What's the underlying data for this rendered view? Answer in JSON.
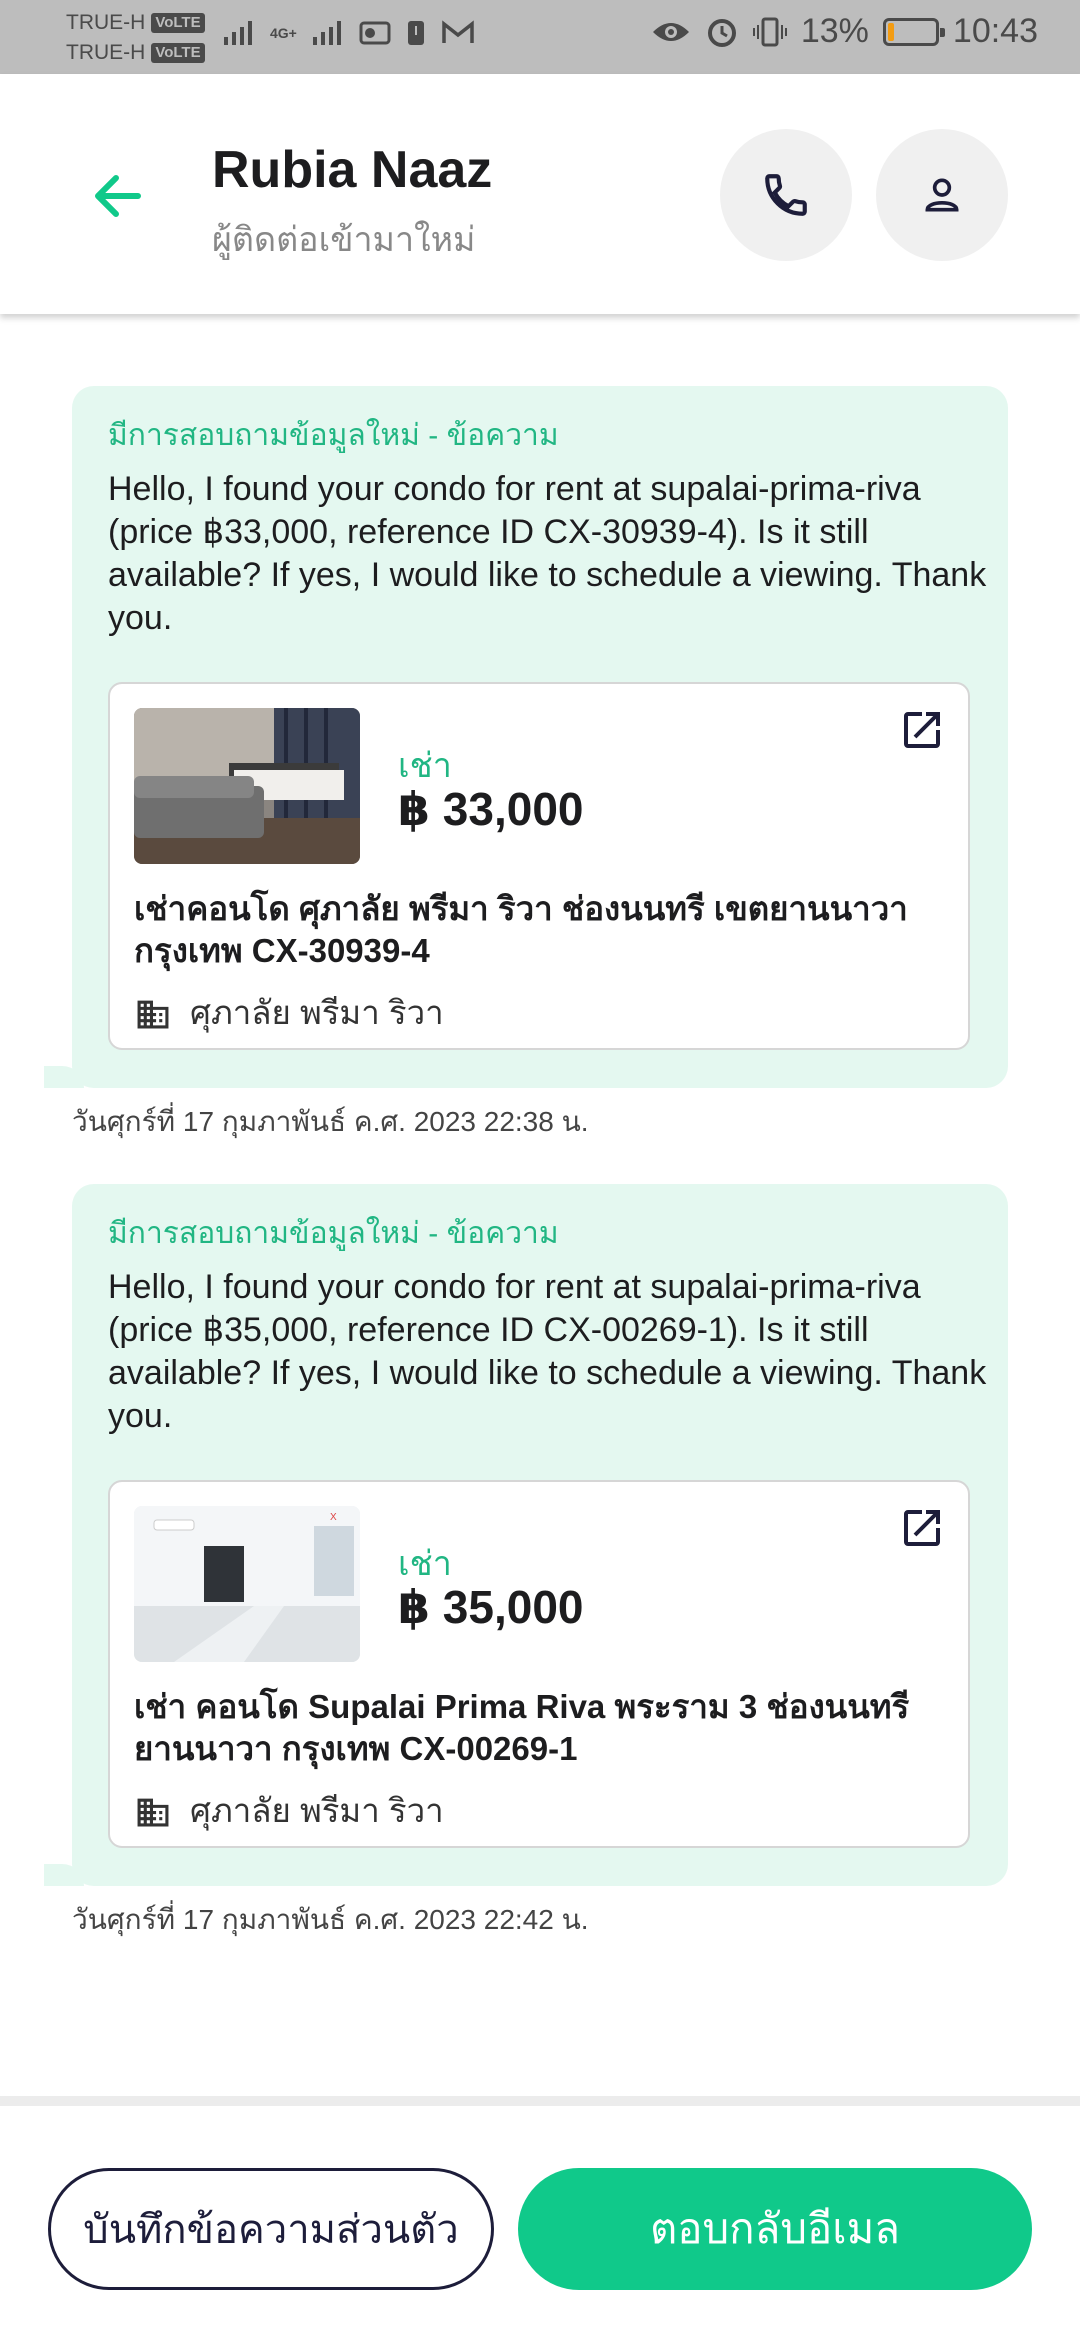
{
  "status_bar": {
    "carrier1": "TRUE-H",
    "carrier2": "TRUE-H",
    "volte": "VoLTE",
    "network": "4G+",
    "battery_percent": "13%",
    "battery_level": 0.13,
    "time": "10:43"
  },
  "header": {
    "contact_name": "Rubia Naaz",
    "contact_subtitle": "ผู้ติดต่อเข้ามาใหม่"
  },
  "messages": [
    {
      "header": "มีการสอบถามข้อมูลใหม่ - ข้อความ",
      "body": "Hello, I found your condo for rent at supalai-prima-riva (price ฿33,000, reference ID CX-30939-4). Is it still available? If yes, I would like to schedule a viewing. Thank you.",
      "listing": {
        "type": "เช่า",
        "price": "฿ 33,000",
        "title": "เช่าคอนโด  ศุภาลัย พรีมา ริวา ช่องนนทรี เขตยานนาวา กรุงเทพ CX-30939-4",
        "project": "ศุภาลัย พรีมา ริวา"
      },
      "timestamp": "วันศุกร์ที่ 17 กุมภาพันธ์ ค.ศ. 2023 22:38 น."
    },
    {
      "header": "มีการสอบถามข้อมูลใหม่ - ข้อความ",
      "body": "Hello, I found your condo for rent at supalai-prima-riva (price ฿35,000, reference ID CX-00269-1). Is it still available? If yes, I would like to schedule a viewing. Thank you.",
      "listing": {
        "type": "เช่า",
        "price": "฿ 35,000",
        "title": "เช่า คอนโด  Supalai Prima Riva  พระราม 3 ช่องนนทรี ยานนาวา กรุงเทพ CX-00269-1",
        "project": "ศุภาลัย พรีมา ริวา"
      },
      "timestamp": "วันศุกร์ที่ 17 กุมภาพันธ์ ค.ศ. 2023 22:42 น."
    }
  ],
  "actions": {
    "private_note_label": "บันทึกข้อความส่วนตัว",
    "reply_email_label": "ตอบกลับอีเมล"
  },
  "colors": {
    "accent": "#10c98a",
    "bubble_bg": "#e4f8f0",
    "accent_text": "#21b683"
  },
  "icons": [
    "back-arrow-icon",
    "phone-icon",
    "person-icon",
    "open-external-icon",
    "building-icon"
  ]
}
